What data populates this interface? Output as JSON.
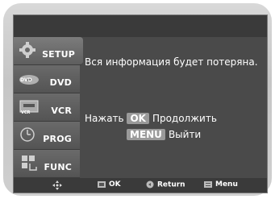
{
  "sidebar": {
    "items": [
      {
        "label": "SETUP",
        "icon": "gear-icon"
      },
      {
        "label": "DVD",
        "icon": "dvd-icon"
      },
      {
        "label": "VCR",
        "icon": "vcr-icon"
      },
      {
        "label": "PROG",
        "icon": "timer-icon"
      },
      {
        "label": "FUNC",
        "icon": "function-icon"
      }
    ]
  },
  "message": {
    "warning": "Вся информация будет потеряна.",
    "ok_key": "OK",
    "ok_prefix": "Нажать",
    "ok_action": "Продолжить",
    "menu_key": "MENU",
    "menu_action": "Выйти"
  },
  "footer": {
    "ok_label": "OK",
    "return_label": "Return",
    "menu_label": "Menu"
  }
}
